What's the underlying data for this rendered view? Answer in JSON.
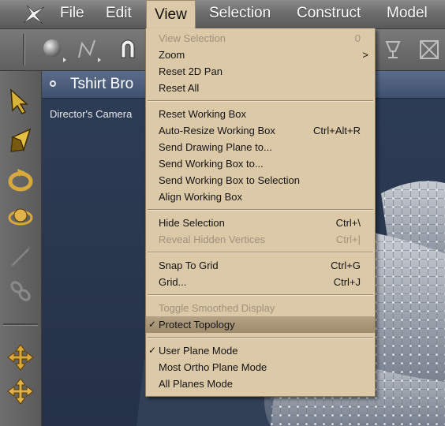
{
  "menubar": {
    "items": [
      "File",
      "Edit",
      "View",
      "Selection",
      "Construct",
      "Model"
    ],
    "active": "View"
  },
  "document": {
    "title": "Tshirt Bro",
    "viewport_label": "Director's Camera"
  },
  "view_menu": {
    "view_selection": {
      "label": "View Selection",
      "shortcut": "0"
    },
    "zoom": {
      "label": "Zoom",
      "submenu": ">"
    },
    "reset_2d_pan": {
      "label": "Reset 2D Pan"
    },
    "reset_all": {
      "label": "Reset All"
    },
    "reset_working_box": {
      "label": "Reset Working Box"
    },
    "auto_resize": {
      "label": "Auto-Resize Working Box",
      "shortcut": "Ctrl+Alt+R"
    },
    "send_drawing_plane": {
      "label": "Send Drawing Plane to..."
    },
    "send_working_box": {
      "label": "Send Working Box to..."
    },
    "send_box_selection": {
      "label": "Send Working Box to Selection"
    },
    "align_working_box": {
      "label": "Align Working Box"
    },
    "hide_selection": {
      "label": "Hide Selection",
      "shortcut": "Ctrl+\\"
    },
    "reveal_hidden": {
      "label": "Reveal Hidden Vertices",
      "shortcut": "Ctrl+|"
    },
    "snap_to_grid": {
      "label": "Snap To Grid",
      "shortcut": "Ctrl+G"
    },
    "grid": {
      "label": "Grid...",
      "shortcut": "Ctrl+J"
    },
    "toggle_smoothed": {
      "label": "Toggle Smoothed Display"
    },
    "protect_topology": {
      "label": "Protect Topology",
      "check": "✓"
    },
    "user_plane_mode": {
      "label": "User Plane Mode",
      "check": "✓"
    },
    "most_ortho_plane_mode": {
      "label": "Most Ortho Plane Mode"
    },
    "all_planes_mode": {
      "label": "All Planes Mode"
    }
  },
  "colors": {
    "menu_bg": "#dcc9a8",
    "highlight": "#a8957a",
    "viewport_bg": "#2d3c55"
  }
}
